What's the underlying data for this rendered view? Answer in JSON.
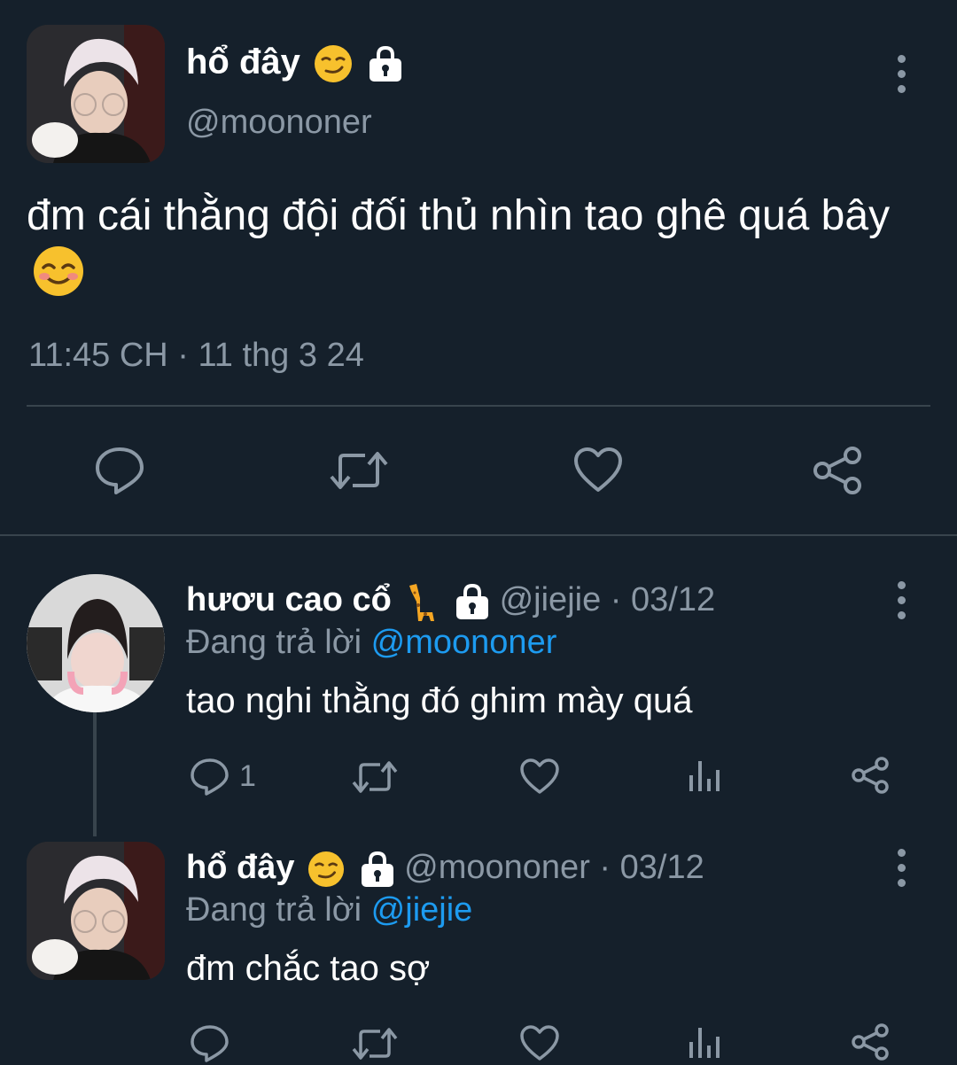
{
  "main_tweet": {
    "display_name": "hổ đây",
    "handle": "@moononer",
    "text": "đm cái thằng đội đối thủ nhìn tao ghê quá bây",
    "timestamp": "11:45 CH · 11 thg 3 24",
    "name_emoji_icon": "smirking-face-icon",
    "text_emoji_icon": "smiling-face-icon",
    "actions": [
      "reply-icon",
      "retweet-icon",
      "like-icon",
      "share-icon"
    ]
  },
  "replies": [
    {
      "display_name": "hươu cao cổ",
      "name_emoji_icon": "giraffe-icon",
      "handle": "@jiejie",
      "date": "· 03/12",
      "replying_prefix": "Đang trả lời",
      "replying_to": "@moononer",
      "text": "tao nghi thằng đó ghim mày quá",
      "reply_count": "1"
    },
    {
      "display_name": "hổ đây",
      "name_emoji_icon": "smirking-face-icon",
      "handle": "@moononer",
      "date": "· 03/12",
      "replying_prefix": "Đang trả lời",
      "replying_to": "@jiejie",
      "text": "đm chắc tao sợ",
      "reply_count": ""
    }
  ],
  "colors": {
    "background": "#15202b",
    "text": "#ffffff",
    "muted": "#8b98a5",
    "link": "#1d9bf0",
    "divider": "#38444d",
    "emoji_yellow": "#f7c12d"
  }
}
